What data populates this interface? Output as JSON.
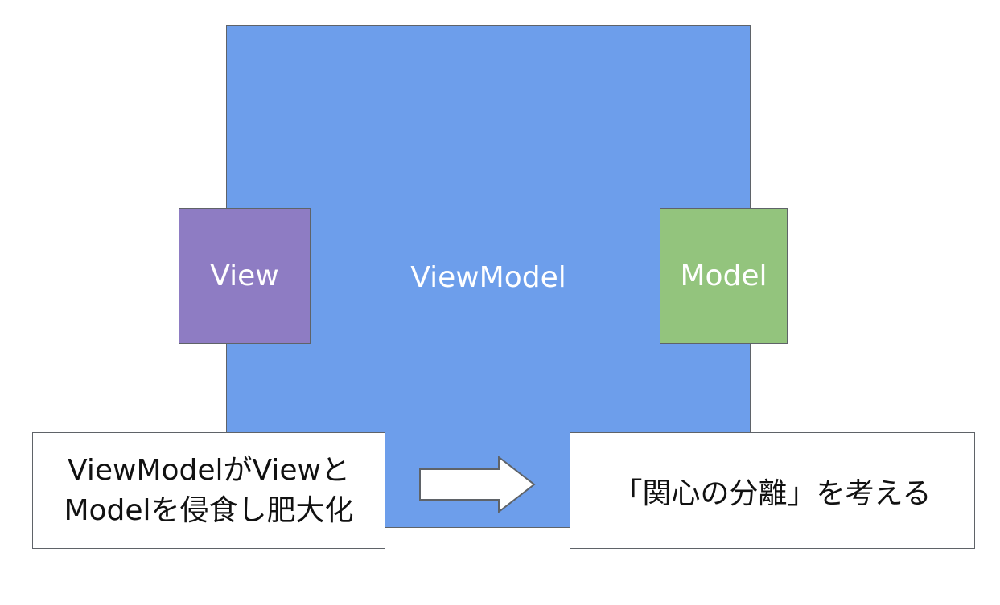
{
  "diagram": {
    "viewmodel_label": "ViewModel",
    "view_label": "View",
    "model_label": "Model",
    "problem_line1": "ViewModelがViewと",
    "problem_line2": "Modelを侵食し肥大化",
    "solution_label": "「関心の分離」を考える"
  },
  "colors": {
    "viewmodel": "#6d9eeb",
    "view": "#8e7cc3",
    "model": "#93c47d",
    "text_light": "#ffffff",
    "text_dark": "#111111"
  },
  "icons": {
    "arrow": "right-arrow-icon"
  }
}
